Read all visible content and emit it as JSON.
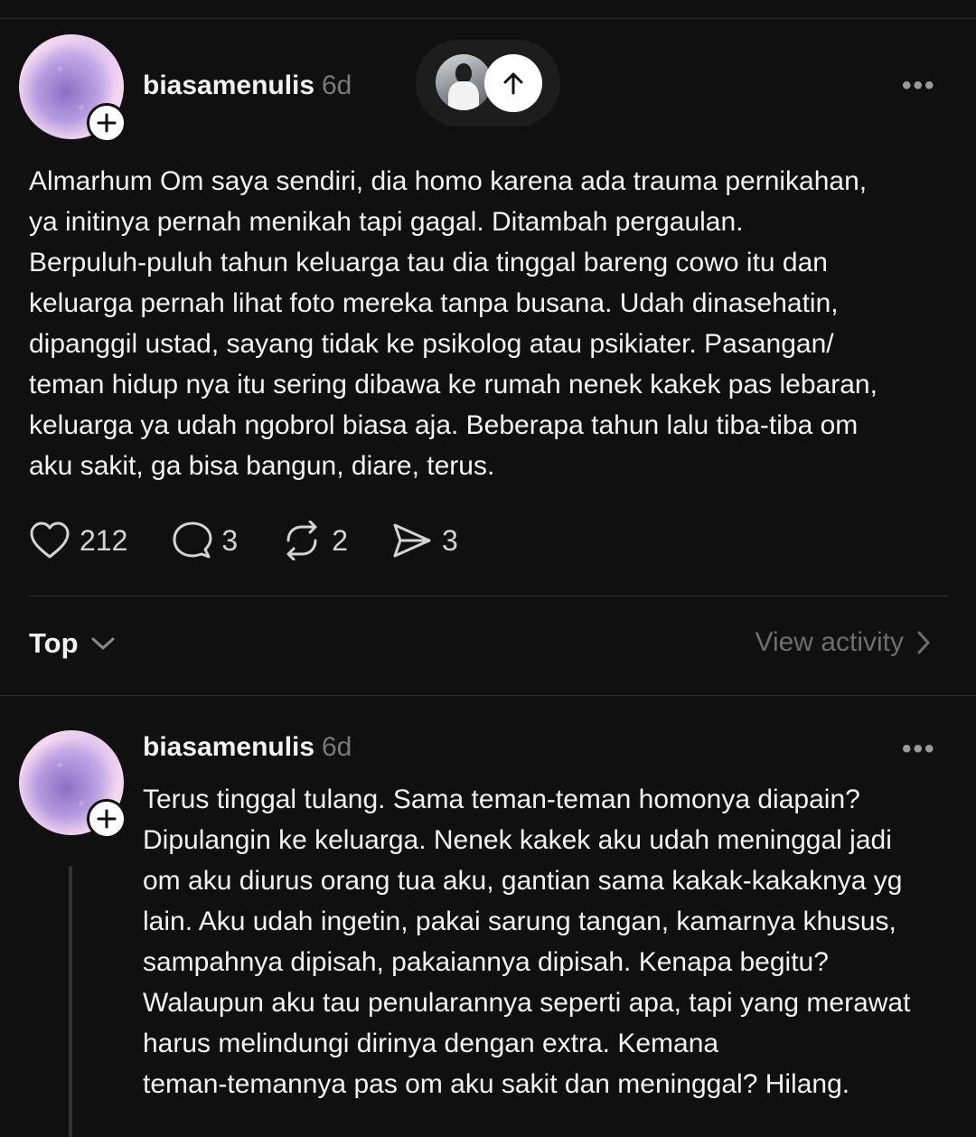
{
  "post": {
    "username": "biasamenulis",
    "time": "6d",
    "more_label": "•••",
    "text": "Almarhum Om saya sendiri, dia homo karena ada trauma pernikahan,\nya initinya pernah menikah tapi gagal. Ditambah pergaulan.\nBerpuluh-puluh tahun keluarga tau dia tinggal bareng cowo itu dan\nkeluarga pernah lihat foto mereka tanpa busana. Udah dinasehatin,\ndipanggil ustad, sayang tidak ke psikolog atau psikiater. Pasangan/\nteman hidup nya itu sering dibawa ke rumah nenek kakek pas lebaran,\nkeluarga ya udah ngobrol biasa aja. Beberapa tahun lalu tiba-tiba om\naku sakit, ga bisa bangun, diare, terus.",
    "likes": "212",
    "comments": "3",
    "reposts": "2",
    "shares": "3"
  },
  "sort": {
    "label": "Top",
    "view_activity": "View activity"
  },
  "reply": {
    "username": "biasamenulis",
    "time": "6d",
    "more_label": "•••",
    "text": "Terus tinggal tulang. Sama teman-teman homonya diapain?\nDipulangin ke keluarga. Nenek kakek aku udah meninggal jadi\nom aku diurus orang tua aku, gantian sama kakak-kakaknya yg\nlain. Aku udah ingetin, pakai sarung tangan, kamarnya khusus,\nsampahnya dipisah, pakaiannya dipisah. Kenapa begitu?\nWalaupun aku tau penularannya seperti apa, tapi yang merawat\nharus melindungi dirinya dengan extra. Kemana\nteman-temannya pas om aku sakit dan meninggal? Hilang."
  },
  "colors": {
    "background": "#101010",
    "text": "#f3f3f3",
    "muted": "#7a7a7a",
    "divider": "#2e2e2e"
  }
}
